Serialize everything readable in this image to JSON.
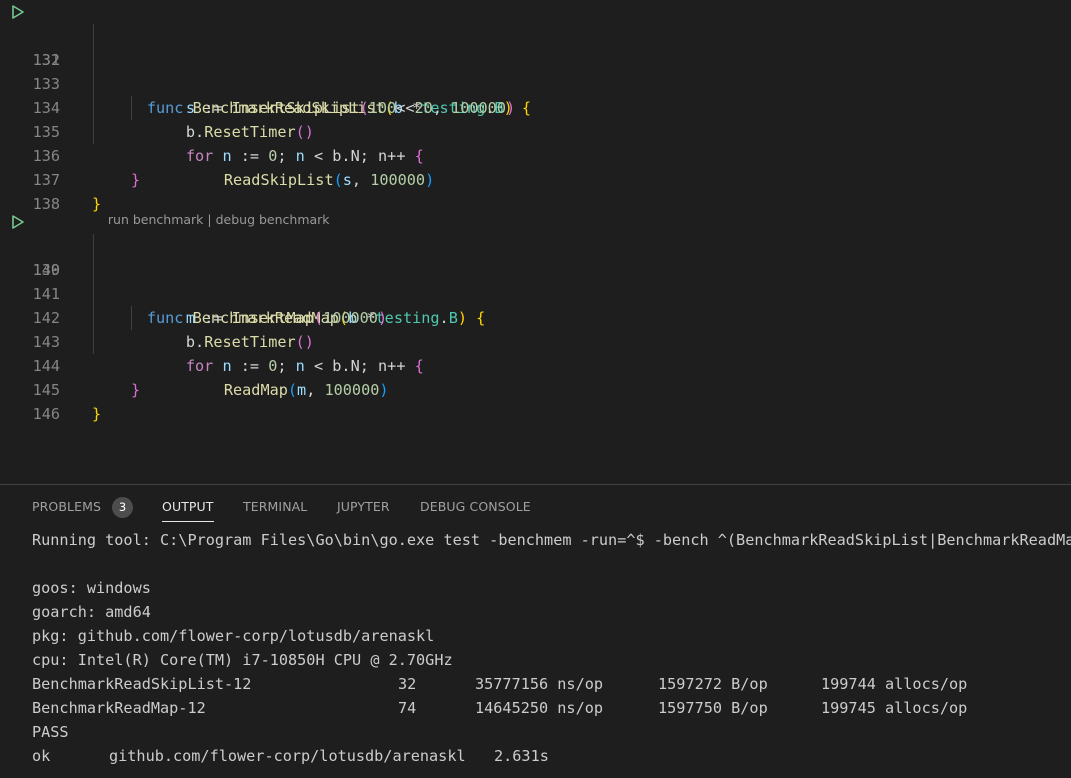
{
  "editor": {
    "codelens": {
      "run_label": "run benchmark",
      "separator": " | ",
      "debug_label": "debug benchmark"
    },
    "lines": [
      {
        "num": "131",
        "run": true
      },
      {
        "num": "132"
      },
      {
        "num": "133"
      },
      {
        "num": "134"
      },
      {
        "num": "135"
      },
      {
        "num": "136"
      },
      {
        "num": "137"
      },
      {
        "num": "138"
      },
      {
        "num": "139",
        "run": true
      },
      {
        "num": "140"
      },
      {
        "num": "141"
      },
      {
        "num": "142"
      },
      {
        "num": "143"
      },
      {
        "num": "144"
      },
      {
        "num": "145"
      },
      {
        "num": "146"
      }
    ],
    "code": {
      "l131": [
        "func",
        " ",
        "BenchmarkReadSkipList",
        "(",
        "b",
        " *",
        "testing",
        ".",
        "B",
        ") ",
        "{"
      ],
      "l132": [
        "s",
        " := ",
        "InsertSkipList",
        "(",
        "100",
        "<<",
        "20",
        ", ",
        "100000",
        ")"
      ],
      "l133": [
        "b",
        ".",
        "ResetTimer",
        "()"
      ],
      "l134": [
        "for",
        " ",
        "n",
        " := ",
        "0",
        "; ",
        "n",
        " < ",
        "b",
        ".",
        "N",
        "; ",
        "n",
        "++ ",
        "{"
      ],
      "l135": [
        "ReadSkipList",
        "(",
        "s",
        ", ",
        "100000",
        ")"
      ],
      "l136": [
        "}"
      ],
      "l137": [
        "}"
      ],
      "l139": [
        "func",
        " ",
        "BenchmarkReadMap",
        "(",
        "b",
        " *",
        "testing",
        ".",
        "B",
        ") ",
        "{"
      ],
      "l140": [
        "m",
        " := ",
        "InsertMap",
        "(",
        "100000",
        ")"
      ],
      "l141": [
        "b",
        ".",
        "ResetTimer",
        "()"
      ],
      "l142": [
        "for",
        " ",
        "n",
        " := ",
        "0",
        "; ",
        "n",
        " < ",
        "b",
        ".",
        "N",
        "; ",
        "n",
        "++ ",
        "{"
      ],
      "l143": [
        "ReadMap",
        "(",
        "m",
        ", ",
        "100000",
        ")"
      ],
      "l144": [
        "}"
      ],
      "l145": [
        "}"
      ]
    }
  },
  "panel": {
    "tabs": [
      {
        "label": "PROBLEMS",
        "badge": "3"
      },
      {
        "label": "OUTPUT",
        "active": true
      },
      {
        "label": "TERMINAL"
      },
      {
        "label": "JUPYTER"
      },
      {
        "label": "DEBUG CONSOLE"
      }
    ],
    "output": {
      "running": "Running tool: C:\\Program Files\\Go\\bin\\go.exe test -benchmem -run=^$ -bench ^(BenchmarkReadSkipList|BenchmarkReadMap)$ github.com/flower-corp/lotusdb/arenaskl",
      "goos": "goos: windows",
      "goarch": "goarch: amd64",
      "pkg": "pkg: github.com/flower-corp/lotusdb/arenaskl",
      "cpu": "cpu: Intel(R) Core(TM) i7-10850H CPU @ 2.70GHz",
      "results": [
        {
          "name": "BenchmarkReadSkipList-12",
          "iters": "32",
          "ns": "35777156 ns/op",
          "bytes": "1597272 B/op",
          "allocs": "199744 allocs/op"
        },
        {
          "name": "BenchmarkReadMap-12",
          "iters": "74",
          "ns": "14645250 ns/op",
          "bytes": "1597750 B/op",
          "allocs": "199745 allocs/op"
        }
      ],
      "pass": "PASS",
      "ok_status": "ok",
      "ok_pkg": "github.com/flower-corp/lotusdb/arenaskl",
      "ok_time": "2.631s"
    }
  }
}
